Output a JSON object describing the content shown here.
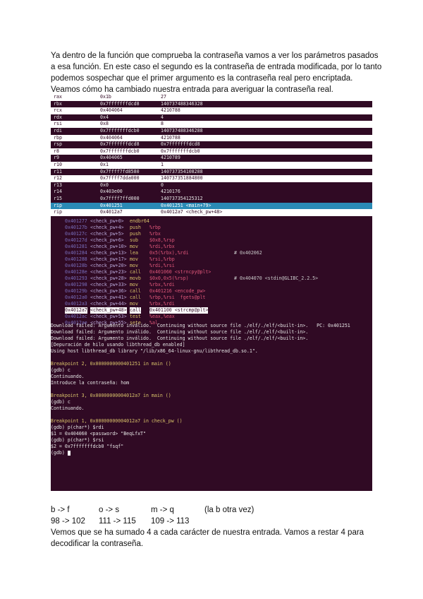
{
  "intro": "Ya dentro de la función que comprueba la contraseña vamos a ver los parámetros pasados a esa función. En este caso el segundo es la contraseña de entrada modificada, por lo tanto podemos sospechar que el primer argumento es la contraseña real pero encriptada. Veamos cómo ha cambiado nuestra entrada para averiguar la contraseña real.",
  "terminal": {
    "registers": [
      {
        "name": "rax",
        "hex": "0x1b",
        "dec": "27"
      },
      {
        "name": "rbx",
        "hex": "0x7fffffffdcd8",
        "dec": "140737488346328"
      },
      {
        "name": "rcx",
        "hex": "0x404064",
        "dec": "4210788"
      },
      {
        "name": "rdx",
        "hex": "0x4",
        "dec": "4"
      },
      {
        "name": "rsi",
        "hex": "0x8",
        "dec": "8"
      },
      {
        "name": "rdi",
        "hex": "0x7fffffffdcb0",
        "dec": "140737488346288"
      },
      {
        "name": "rbp",
        "hex": "0x404064",
        "dec": "4210788"
      },
      {
        "name": "rsp",
        "hex": "0x7fffffffdcd8",
        "dec": "0x7fffffffdcd8"
      },
      {
        "name": "r8",
        "hex": "0x7fffffffdcb0",
        "dec": "0x7fffffffdcb0"
      },
      {
        "name": "r9",
        "hex": "0x404065",
        "dec": "4210789"
      },
      {
        "name": "r10",
        "hex": "0x1",
        "dec": "1"
      },
      {
        "name": "r11",
        "hex": "0x7ffff7fd8580",
        "dec": "140737354108288"
      },
      {
        "name": "r12",
        "hex": "0x7ffff7dda000",
        "dec": "140737351884800"
      },
      {
        "name": "r13",
        "hex": "0x0",
        "dec": "0"
      },
      {
        "name": "r14",
        "hex": "0x403e00",
        "dec": "4210176"
      },
      {
        "name": "r15",
        "hex": "0x7ffff7ffd000",
        "dec": "140737354125312"
      },
      {
        "name": "rip",
        "hex": "0x401251",
        "dec": "0x401251 <main+79>"
      },
      {
        "name": "rip",
        "hex": "0x4012a7",
        "dec": "0x4012a7 <check_pw+48>"
      }
    ],
    "code": [
      {
        "addr": "0x401277",
        "func": "<check_pw+0>",
        "op": "endbr64",
        "args": "",
        "comment": ""
      },
      {
        "addr": "0x40127b",
        "func": "<check_pw+4>",
        "op": "push",
        "args": "%rbp",
        "comment": ""
      },
      {
        "addr": "0x40127c",
        "func": "<check_pw+5>",
        "op": "push",
        "args": "%rbx",
        "comment": ""
      },
      {
        "addr": "0x40127d",
        "func": "<check_pw+6>",
        "op": "sub",
        "args": "$0x8,%rsp",
        "comment": ""
      },
      {
        "addr": "0x401281",
        "func": "<check_pw+10>",
        "op": "mov",
        "args": "%rdi,%rbx",
        "comment": ""
      },
      {
        "addr": "0x401284",
        "func": "<check_pw+13>",
        "op": "lea",
        "args": "0x5(%rbx),%rdi",
        "comment": "# 0x402062"
      },
      {
        "addr": "0x401288",
        "func": "<check_pw+17>",
        "op": "mov",
        "args": "%rsi,%rbp",
        "comment": ""
      },
      {
        "addr": "0x40128b",
        "func": "<check_pw+20>",
        "op": "mov",
        "args": "%rdi,%rsi",
        "comment": ""
      },
      {
        "addr": "0x40128e",
        "func": "<check_pw+23>",
        "op": "call",
        "args": "0x401060 <strncpy@plt>",
        "comment": ""
      },
      {
        "addr": "0x401293",
        "func": "<check_pw+28>",
        "op": "movb",
        "args": "$0x0,0x5(%rsp)",
        "comment": "# 0x404070 <stdin@GLIBC_2.2.5>"
      },
      {
        "addr": "0x401298",
        "func": "<check_pw+33>",
        "op": "mov",
        "args": "%rbx,%rdi",
        "comment": ""
      },
      {
        "addr": "0x40129b",
        "func": "<check_pw+36>",
        "op": "call",
        "args": "0x401216 <encode_pw>",
        "comment": ""
      },
      {
        "addr": "0x4012a0",
        "func": "<check_pw+41>",
        "op": "call",
        "args": "%rbp,%rsi  fgets@plt",
        "comment": ""
      },
      {
        "addr": "0x4012a3",
        "func": "<check_pw+44>",
        "op": "mov",
        "args": "%rbx,%rdi",
        "comment": ""
      },
      {
        "addr": "0x4012a7",
        "func": "<check_pw+48>",
        "op": "call",
        "args": "0x401100 <strcmp@plt>",
        "comment": ""
      },
      {
        "addr": "0x4012ac",
        "func": "<check_pw+53>",
        "op": "test",
        "args": "%eax,%eax",
        "comment": ""
      },
      {
        "addr": "0x4012ae",
        "func": "<check_pw+55>",
        "op": "sete",
        "args": "%al",
        "comment": ""
      }
    ],
    "log": [
      "Download failed: Argumento inválido.  Continuing without source file ./elf/./elf/<built-in>.   PC: 0x401251",
      "Download failed: Argumento inválido.  Continuing without source file ./elf/./elf/<built-in>.",
      "Download failed: Argumento inválido.  Continuing without source file ./elf/./elf/<built-in>.",
      "[Depuración de hilo usando libthread_db enabled]",
      "Using host libthread_db library \"/lib/x86_64-linux-gnu/libthread_db.so.1\".",
      "",
      "Breakpoint 2, 0x0000000000401251 in main ()",
      "(gdb) c",
      "Continuando.",
      "Introduce la contraseña: hom",
      "",
      "Breakpoint 3, 0x00000000004012a7 in main ()",
      "(gdb) c",
      "Continuando.",
      "",
      "Breakpoint 1, 0x00000000004012a7 in check_pw ()",
      "(gdb) p(char*) $rdi",
      "$1 = 0x404060 <password> \"BeqLfxT\"",
      "(gdb) p(char*) $rsi",
      "$2 = 0x7fffffffdcb0 \"fsqf\"",
      "(gdb) "
    ]
  },
  "mapping": {
    "chars": [
      "b  -> f",
      "o  -> s",
      "m  -> q",
      "(la b otra vez)"
    ],
    "codes": [
      "98 -> 102",
      "111 -> 115",
      "109 -> 113",
      ""
    ]
  },
  "outro": "Vemos que se ha sumado 4 a cada carácter de nuestra entrada. Vamos a restar 4 para decodificar la contraseña."
}
